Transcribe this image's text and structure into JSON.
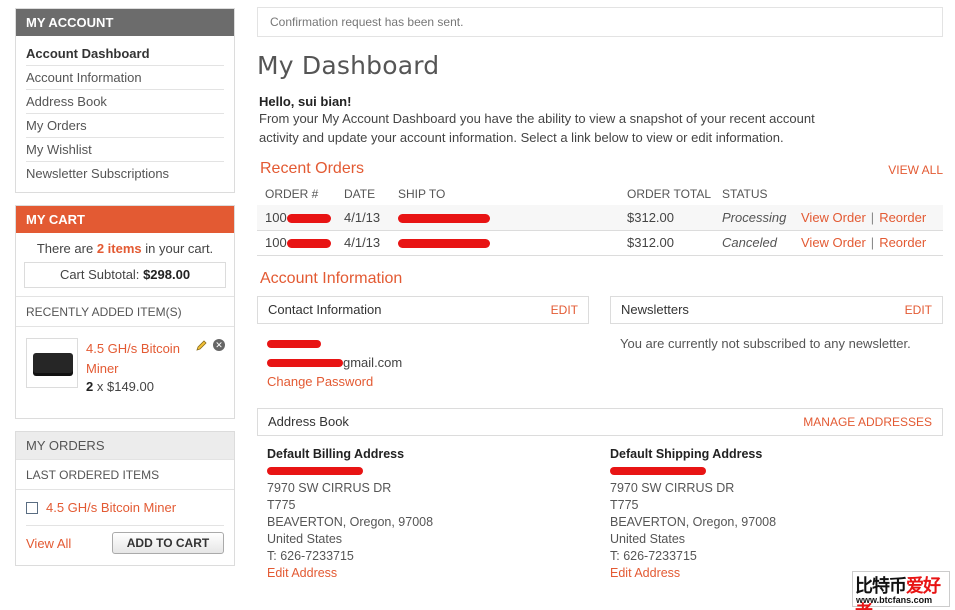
{
  "sidebar": {
    "account_title": "MY ACCOUNT",
    "nav": [
      {
        "label": "Account Dashboard"
      },
      {
        "label": "Account Information"
      },
      {
        "label": "Address Book"
      },
      {
        "label": "My Orders"
      },
      {
        "label": "My Wishlist"
      },
      {
        "label": "Newsletter Subscriptions"
      }
    ],
    "cart": {
      "title": "MY CART",
      "there_are": "There are",
      "items_count": "2 items",
      "in_cart": "in your cart.",
      "subtotal_label": "Cart Subtotal:",
      "subtotal_value": "$298.00",
      "recent_title": "RECENTLY ADDED ITEM(S)",
      "item": {
        "name": "4.5 GH/s Bitcoin Miner",
        "qty": "2",
        "price": "$149.00",
        "x": "x"
      }
    },
    "orders": {
      "title": "MY ORDERS",
      "last_title": "LAST ORDERED ITEMS",
      "item": "4.5 GH/s Bitcoin Miner",
      "view_all": "View All",
      "add_to_cart": "ADD TO CART"
    }
  },
  "main": {
    "notice": "Confirmation request has been sent.",
    "title": "My Dashboard",
    "hello": "Hello, sui bian!",
    "intro": "From your My Account Dashboard you have the ability to view a snapshot of your recent account activity and update your account information. Select a link below to view or edit information.",
    "recent_orders": {
      "title": "Recent Orders",
      "view_all": "VIEW ALL",
      "headers": {
        "order": "ORDER #",
        "date": "DATE",
        "ship_to": "SHIP TO",
        "total": "ORDER TOTAL",
        "status": "STATUS"
      },
      "rows": [
        {
          "order": "100",
          "date": "4/1/13",
          "total": "$312.00",
          "status": "Processing",
          "view": "View Order",
          "reorder": "Reorder"
        },
        {
          "order": "100",
          "date": "4/1/13",
          "total": "$312.00",
          "status": "Canceled",
          "view": "View Order",
          "reorder": "Reorder"
        }
      ]
    },
    "account_info": {
      "title": "Account Information",
      "contact_title": "Contact Information",
      "edit": "EDIT",
      "email_suffix": "gmail.com",
      "change_password": "Change Password",
      "newsletters_title": "Newsletters",
      "newsletters_text": "You are currently not subscribed to any newsletter."
    },
    "address_book": {
      "title": "Address Book",
      "manage": "MANAGE ADDRESSES",
      "billing": {
        "title": "Default Billing Address",
        "street": "7970 SW CIRRUS DR",
        "unit": "T775",
        "city": "BEAVERTON, Oregon, 97008",
        "country": "United States",
        "phone": "T: 626-7233715",
        "edit": "Edit Address"
      },
      "shipping": {
        "title": "Default Shipping Address",
        "street": "7970 SW CIRRUS DR",
        "unit": "T775",
        "city": "BEAVERTON, Oregon, 97008",
        "country": "United States",
        "phone": "T: 626-7233715",
        "edit": "Edit Address"
      }
    }
  },
  "watermark": {
    "top_black": "比特币",
    "top_red": "爱好者",
    "bottom": "www.btcfans.com"
  },
  "colors": {
    "accent": "#e35a33",
    "sidebar_dark": "#6c6c6c",
    "redaction": "#e81414"
  }
}
